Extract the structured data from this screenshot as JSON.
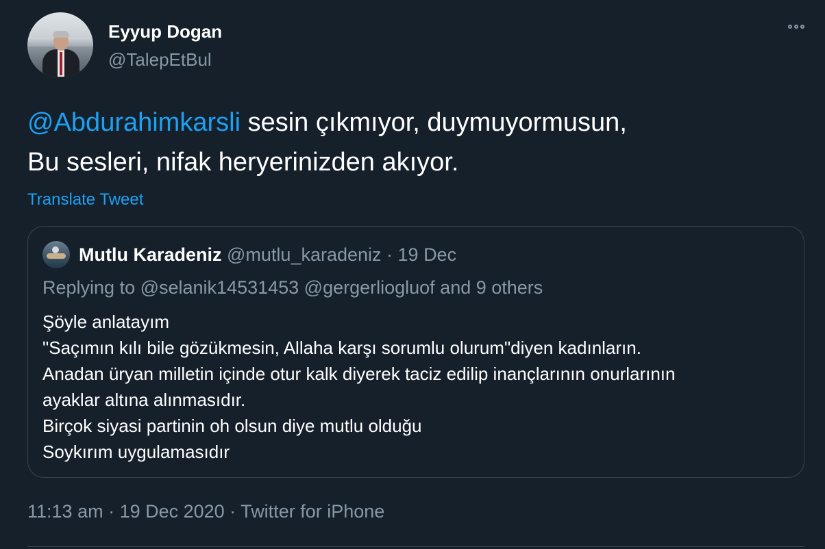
{
  "author": {
    "display_name": "Eyyup Dogan",
    "handle": "@TalepEtBul"
  },
  "tweet": {
    "mention": "@Abdurahimkarsli",
    "text_line1_rest": " sesin çıkmıyor, duymuyormusun,",
    "text_line2": "Bu sesleri, nifak heryerinizden akıyor.",
    "translate_label": "Translate Tweet"
  },
  "quoted_tweet": {
    "display_name": "Mutlu Karadeniz",
    "meta": " @mutlu_karadeniz · 19 Dec",
    "replying_to": "Replying to @selanik14531453 @gergerliogluof  and 9 others",
    "lines": [
      "Şöyle anlatayım",
      "\"Saçımın kılı bile gözükmesin, Allaha karşı sorumlu olurum\"diyen kadınların.",
      "Anadan üryan milletin içinde otur kalk diyerek taciz edilip inançlarının onurlarının",
      "ayaklar altına alınmasıdır.",
      "Birçok siyasi partinin oh olsun diye mutlu olduğu",
      "Soykırım uygulamasıdır"
    ]
  },
  "timestamp": "11:13 am · 19 Dec 2020 · Twitter for iPhone",
  "icons": {
    "more": "more-horizontal-icon"
  },
  "colors": {
    "background": "#15202b",
    "link": "#1da1f2",
    "secondary_text": "#8899a6",
    "border": "#38444d"
  }
}
